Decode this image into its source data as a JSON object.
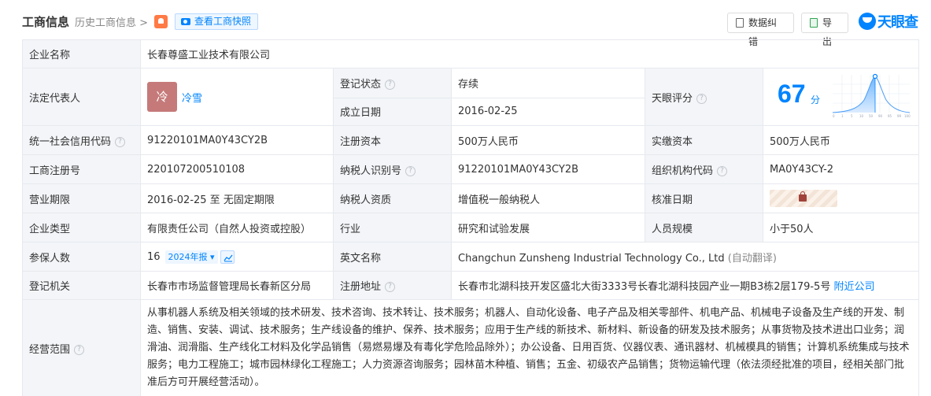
{
  "header": {
    "title": "工商信息",
    "history_link": "历史工商信息 >",
    "snapshot_button": "查看工商快照",
    "correct_button": "数据纠错",
    "export_button": "导出",
    "logo_text": "天眼查"
  },
  "rows": {
    "company_name_label": "企业名称",
    "company_name": "长春尊盛工业技术有限公司",
    "legal_rep_label": "法定代表人",
    "legal_rep_avatar": "冷",
    "legal_rep_name": "冷雪",
    "reg_status_label": "登记状态",
    "reg_status": "存续",
    "established_label": "成立日期",
    "established": "2016-02-25",
    "score_label": "天眼评分",
    "score_value": "67",
    "score_unit": "分",
    "credit_code_label": "统一社会信用代码",
    "credit_code": "91220101MA0Y43CY2B",
    "reg_capital_label": "注册资本",
    "reg_capital": "500万人民币",
    "paid_capital_label": "实缴资本",
    "paid_capital": "500万人民币",
    "reg_no_label": "工商注册号",
    "reg_no": "220107200510108",
    "taxpayer_id_label": "纳税人识别号",
    "taxpayer_id": "91220101MA0Y43CY2B",
    "org_code_label": "组织机构代码",
    "org_code": "MA0Y43CY-2",
    "term_label": "营业期限",
    "term": "2016-02-25 至 无固定期限",
    "taxpayer_qual_label": "纳税人资质",
    "taxpayer_qual": "增值税一般纳税人",
    "approval_date_label": "核准日期",
    "type_label": "企业类型",
    "type": "有限责任公司（自然人投资或控股）",
    "industry_label": "行业",
    "industry": "研究和试验发展",
    "staff_label": "人员规模",
    "staff": "小于50人",
    "insured_label": "参保人数",
    "insured": "16",
    "insured_year_tag": "2024年报",
    "english_name_label": "英文名称",
    "english_name": "Changchun Zunsheng Industrial Technology Co., Ltd",
    "english_name_note": "(自动翻译)",
    "authority_label": "登记机关",
    "authority": "长春市市场监督管理局长春新区分局",
    "address_label": "注册地址",
    "address": "长春市北湖科技开发区盛北大街3333号长春北湖科技园产业一期B3栋2层179-5号",
    "nearby_link": "附近公司",
    "scope_label": "经营范围",
    "scope": "从事机器人系统及相关领域的技术研发、技术咨询、技术转让、技术服务；机器人、自动化设备、电子产品及相关零部件、机电产品、机械电子设备及生产线的开发、制造、销售、安装、调试、技术服务；生产线设备的维护、保养、技术服务；应用于生产线的新技术、新材料、新设备的研发及技术服务；从事货物及技术进出口业务；润滑油、润滑脂、生产线化工材料及化学品销售（易燃易爆及有毒化学危险品除外）；办公设备、日用百货、仪器仪表、通讯器材、机械模具的销售；计算机系统集成与技术服务；电力工程施工；城市园林绿化工程施工；人力资源咨询服务；园林苗木种植、销售；五金、初级农产品销售；货物运输代理（依法须经批准的项目，经相关部门批准后方可开展经营活动）。"
  },
  "score_chart": {
    "x_ticks": [
      "0",
      "1",
      "5",
      "10",
      "50",
      "90",
      "95",
      "99",
      "100"
    ]
  },
  "colors": {
    "accent": "#0084ff",
    "status_green": "#12a84f",
    "label_bg": "#f3f5f8"
  }
}
